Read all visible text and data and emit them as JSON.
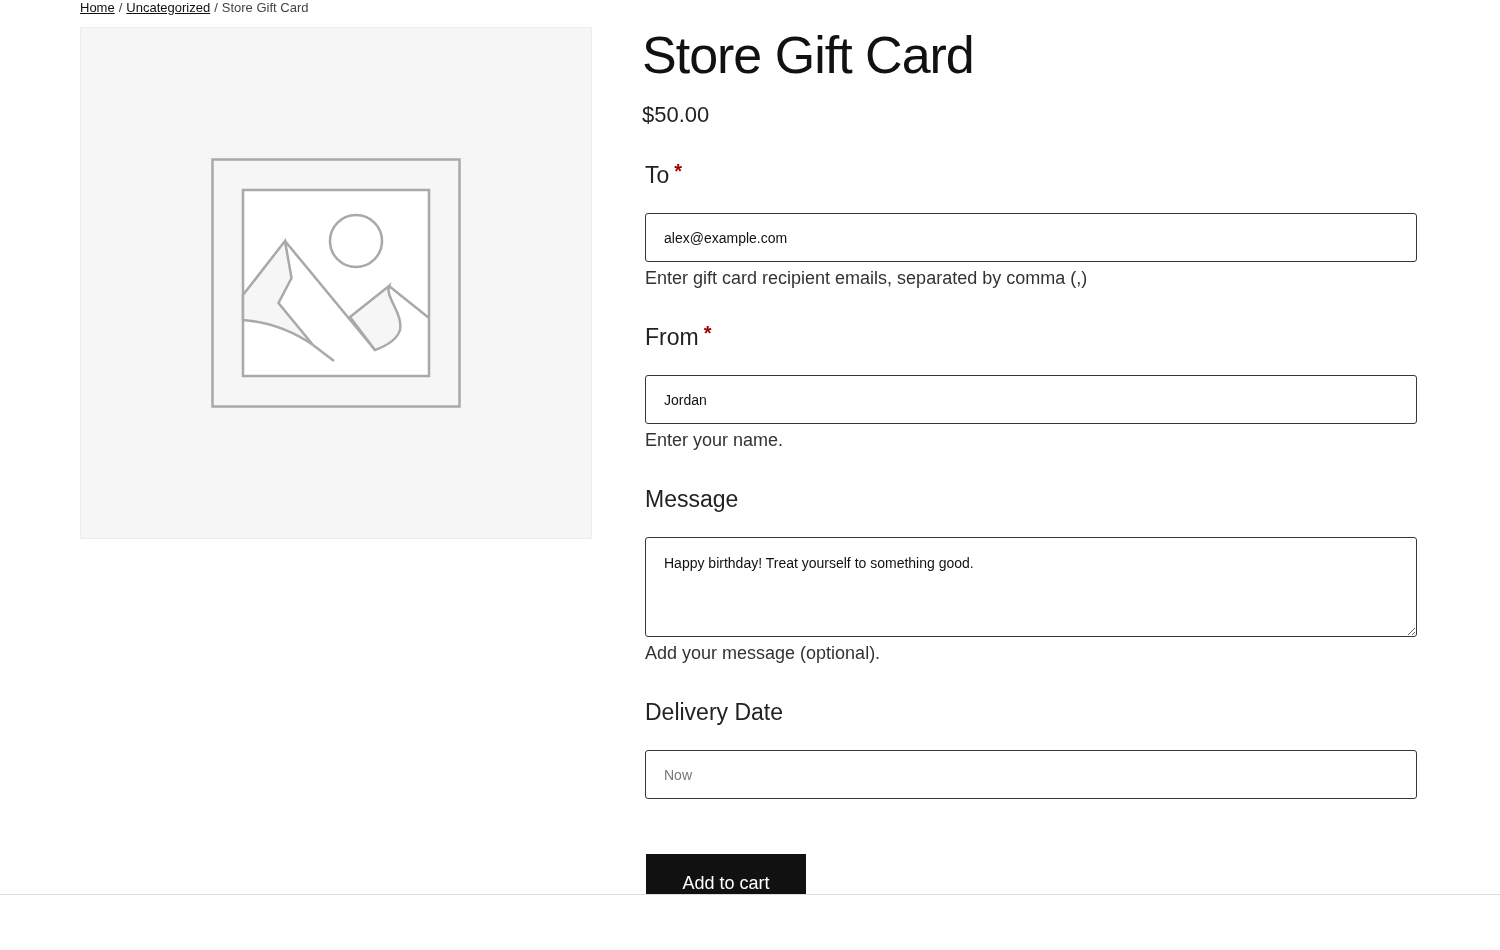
{
  "breadcrumb": [
    {
      "kind": "link",
      "text": "Home"
    },
    {
      "kind": "separator",
      "text": "/"
    },
    {
      "kind": "link",
      "text": "Uncategorized"
    },
    {
      "kind": "separator",
      "text": "/"
    },
    {
      "kind": "current",
      "text": "Store Gift Card"
    }
  ],
  "product": {
    "title": "Store Gift Card",
    "price": "$50.00"
  },
  "fields": [
    {
      "kind": "input",
      "label": "To",
      "required_mark": "*",
      "value": "alex@example.com",
      "help": "Enter gift card recipient emails, separated by comma (,)"
    },
    {
      "kind": "input",
      "label": "From",
      "required_mark": "*",
      "value": "Jordan",
      "help": "Enter your name."
    },
    {
      "kind": "textarea",
      "label": "Message",
      "value": "Happy birthday! Treat yourself to something good.",
      "help": "Add your message (optional)."
    },
    {
      "kind": "input",
      "label": "Delivery Date",
      "placeholder": "Now"
    }
  ],
  "add_to_cart_button": "Add to cart"
}
